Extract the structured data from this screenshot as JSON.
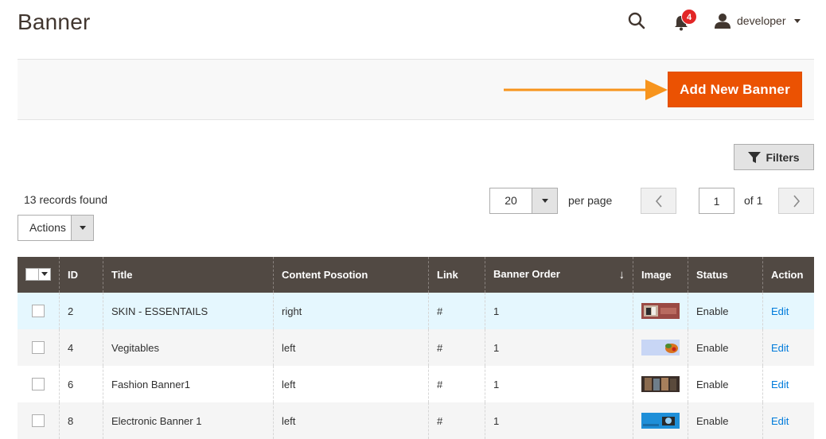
{
  "page": {
    "title": "Banner"
  },
  "header": {
    "notification_count": "4",
    "user_name": "developer"
  },
  "actions_bar": {
    "add_button_label": "Add New Banner",
    "arrow_color": "#f7941d",
    "button_color": "#eb5202"
  },
  "toolbar": {
    "filters_label": "Filters",
    "records_found": "13 records found",
    "per_page_value": "20",
    "per_page_label": "per page",
    "current_page": "1",
    "of_pages": "of 1",
    "mass_actions_label": "Actions"
  },
  "grid": {
    "columns": {
      "id": "ID",
      "title": "Title",
      "content_position": "Content Posotion",
      "link": "Link",
      "banner_order": "Banner Order",
      "image": "Image",
      "status": "Status",
      "action": "Action"
    },
    "rows": [
      {
        "id": "2",
        "title": "SKIN - ESSENTAILS",
        "position": "right",
        "link": "#",
        "order": "1",
        "status": "Enable",
        "action": "Edit"
      },
      {
        "id": "4",
        "title": "Vegitables",
        "position": "left",
        "link": "#",
        "order": "1",
        "status": "Enable",
        "action": "Edit"
      },
      {
        "id": "6",
        "title": "Fashion Banner1",
        "position": "left",
        "link": "#",
        "order": "1",
        "status": "Enable",
        "action": "Edit"
      },
      {
        "id": "8",
        "title": "Electronic Banner 1",
        "position": "left",
        "link": "#",
        "order": "1",
        "status": "Enable",
        "action": "Edit"
      }
    ]
  }
}
